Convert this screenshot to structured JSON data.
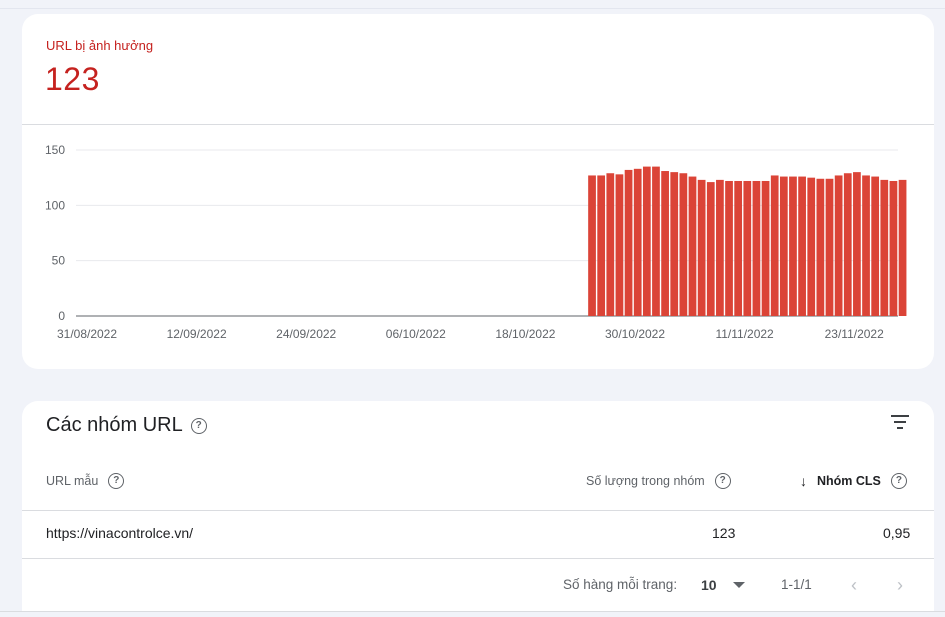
{
  "summary": {
    "label": "URL bị ảnh hưởng",
    "value": "123"
  },
  "chart_data": {
    "type": "bar",
    "ylim": [
      0,
      150
    ],
    "yticks": [
      0,
      50,
      100,
      150
    ],
    "xtick_labels": [
      "31/08/2022",
      "12/09/2022",
      "24/09/2022",
      "06/10/2022",
      "18/10/2022",
      "30/10/2022",
      "11/11/2022",
      "23/11/2022"
    ],
    "x_start": "31/08/2022",
    "x_end": "29/11/2022",
    "bars_start": "26/10/2022",
    "values": [
      127,
      127,
      129,
      128,
      132,
      133,
      135,
      135,
      131,
      130,
      129,
      126,
      123,
      121,
      123,
      122,
      122,
      122,
      122,
      122,
      127,
      126,
      126,
      126,
      125,
      124,
      124,
      127,
      129,
      130,
      127,
      126,
      123,
      122,
      123
    ],
    "bar_color": "#db4437"
  },
  "groups": {
    "title": "Các nhóm URL",
    "columns": {
      "url": "URL mẫu",
      "count": "Số lượng trong nhóm",
      "cls": "Nhóm CLS"
    },
    "rows": [
      {
        "url": "https://vinacontrolce.vn/",
        "count": "123",
        "cls": "0,95"
      }
    ],
    "pagination": {
      "rows_per_page_label": "Số hàng mỗi trang:",
      "rows_per_page": "10",
      "range": "1-1/1"
    }
  }
}
